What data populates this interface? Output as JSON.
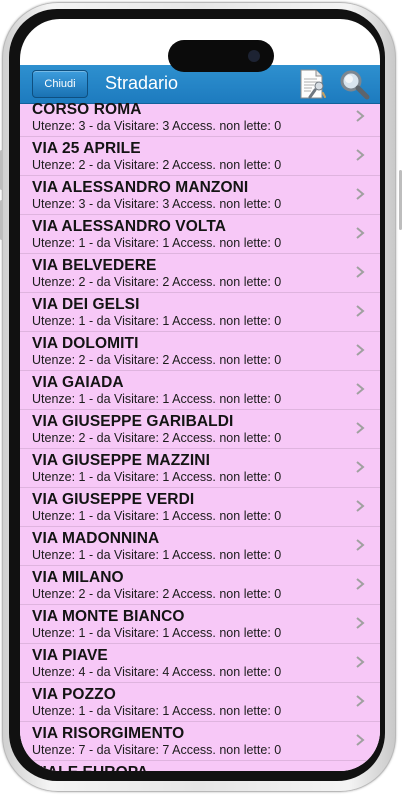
{
  "header": {
    "back_label": "Chiudi",
    "title": "Stradario"
  },
  "streets": [
    {
      "name": "CORSO ROMA",
      "info": "Utenze: 3 - da Visitare: 3 Access. non lette: 0"
    },
    {
      "name": "VIA 25 APRILE",
      "info": "Utenze: 2 - da Visitare: 2 Access. non lette: 0"
    },
    {
      "name": "VIA ALESSANDRO MANZONI",
      "info": "Utenze: 3 - da Visitare: 3 Access. non lette: 0"
    },
    {
      "name": "VIA ALESSANDRO VOLTA",
      "info": "Utenze: 1 - da Visitare: 1 Access. non lette: 0"
    },
    {
      "name": "VIA BELVEDERE",
      "info": "Utenze: 2 - da Visitare: 2 Access. non lette: 0"
    },
    {
      "name": "VIA DEI GELSI",
      "info": "Utenze: 1 - da Visitare: 1 Access. non lette: 0"
    },
    {
      "name": "VIA DOLOMITI",
      "info": "Utenze: 2 - da Visitare: 2 Access. non lette: 0"
    },
    {
      "name": "VIA GAIADA",
      "info": "Utenze: 1 - da Visitare: 1 Access. non lette: 0"
    },
    {
      "name": "VIA GIUSEPPE GARIBALDI",
      "info": "Utenze: 2 - da Visitare: 2 Access. non lette: 0"
    },
    {
      "name": "VIA GIUSEPPE MAZZINI",
      "info": "Utenze: 1 - da Visitare: 1 Access. non lette: 0"
    },
    {
      "name": "VIA GIUSEPPE VERDI",
      "info": "Utenze: 1 - da Visitare: 1 Access. non lette: 0"
    },
    {
      "name": "VIA MADONNINA",
      "info": "Utenze: 1 - da Visitare: 1 Access. non lette: 0"
    },
    {
      "name": "VIA MILANO",
      "info": "Utenze: 2 - da Visitare: 2 Access. non lette: 0"
    },
    {
      "name": "VIA MONTE BIANCO",
      "info": "Utenze: 1 - da Visitare: 1 Access. non lette: 0"
    },
    {
      "name": "VIA PIAVE",
      "info": "Utenze: 4 - da Visitare: 4 Access. non lette: 0"
    },
    {
      "name": "VIA POZZO",
      "info": "Utenze: 1 - da Visitare: 1 Access. non lette: 0"
    },
    {
      "name": "VIA RISORGIMENTO",
      "info": "Utenze: 7 - da Visitare: 7 Access. non lette: 0"
    },
    {
      "name": "VIALE EUROPA",
      "info": ""
    }
  ],
  "icons": {
    "document": "document-edit-icon",
    "search": "search-icon",
    "chevron": "chevron-right-icon"
  },
  "colors": {
    "header": "#1d7bbf",
    "list_background": "#f7c8f7",
    "chevron": "#a0a0a0"
  }
}
